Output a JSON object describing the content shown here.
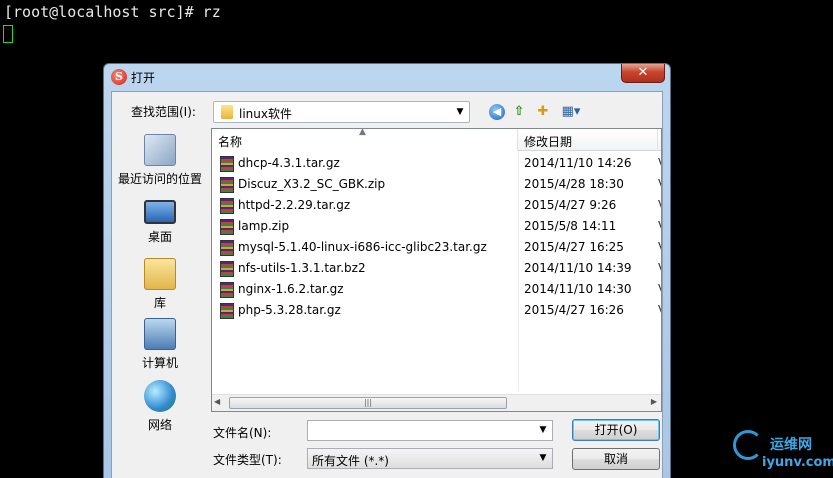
{
  "terminal": {
    "prompt_line": "[root@localhost src]# rz"
  },
  "dialog": {
    "title": "打开",
    "close_label": "✕",
    "lookin_label": "查找范围(I):",
    "lookin_value": "linux软件",
    "places": [
      {
        "label": "最近访问的位置",
        "icon": "recent-places-icon"
      },
      {
        "label": "桌面",
        "icon": "desktop-icon"
      },
      {
        "label": "库",
        "icon": "library-icon"
      },
      {
        "label": "计算机",
        "icon": "computer-icon"
      },
      {
        "label": "网络",
        "icon": "network-icon"
      }
    ],
    "columns": {
      "name": "名称",
      "date": "修改日期",
      "more": "⁞"
    },
    "files": [
      {
        "name": "dhcp-4.3.1.tar.gz",
        "date": "2014/11/10 14:26",
        "more": "V"
      },
      {
        "name": "Discuz_X3.2_SC_GBK.zip",
        "date": "2015/4/28 18:30",
        "more": "V"
      },
      {
        "name": "httpd-2.2.29.tar.gz",
        "date": "2015/4/27 9:26",
        "more": "V"
      },
      {
        "name": "lamp.zip",
        "date": "2015/5/8 14:11",
        "more": "V"
      },
      {
        "name": "mysql-5.1.40-linux-i686-icc-glibc23.tar.gz",
        "date": "2015/4/27 16:25",
        "more": "V"
      },
      {
        "name": "nfs-utils-1.3.1.tar.bz2",
        "date": "2014/11/10 14:39",
        "more": "V"
      },
      {
        "name": "nginx-1.6.2.tar.gz",
        "date": "2014/11/10 14:30",
        "more": "V"
      },
      {
        "name": "php-5.3.28.tar.gz",
        "date": "2015/4/27 16:26",
        "more": "V"
      }
    ],
    "filename_label": "文件名(N):",
    "filename_value": "",
    "filetype_label": "文件类型(T):",
    "filetype_value": "所有文件 (*.*)",
    "open_label": "打开(O)",
    "cancel_label": "取消"
  },
  "watermark": {
    "line1": "运维网",
    "line2": "iyunv.com"
  }
}
